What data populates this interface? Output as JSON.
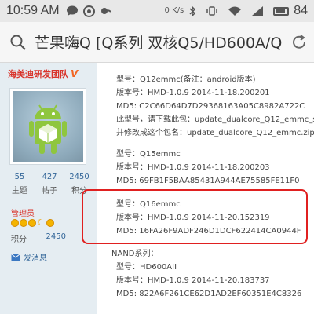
{
  "status_bar": {
    "time": "10:59 AM",
    "net_speed": "0 K/s",
    "battery": "84",
    "battery_level": 0.84,
    "icons": [
      "chat-bubble-icon",
      "circle-icon",
      "weather-icon",
      "bluetooth-icon",
      "vibrate-icon",
      "wifi-icon",
      "signal-icon",
      "battery-icon"
    ]
  },
  "title_bar": {
    "title": "芒果嗨Q [Q系列 双核Q5/HD600A/Q",
    "left_icon": "search-icon",
    "right_icon": "refresh-icon"
  },
  "user": {
    "name": "海美迪研发团队",
    "badge": "V",
    "stats": [
      {
        "value": "55",
        "label": "主题"
      },
      {
        "value": "427",
        "label": "帖子"
      },
      {
        "value": "2450",
        "label": "积分"
      }
    ],
    "role": "管理员",
    "points_label": "积分",
    "points_value": "2450",
    "send_message": "发消息"
  },
  "post": {
    "blocks": [
      {
        "lines": [
          "型号：Q12emmc(备注：android版本)",
          "版本号：HMD-1.0.9 2014-11-18.200201",
          "MD5: C2C66D64D7D29368163A05C8982A722C",
          "此型号，请下载此包：update_dualcore_Q12_emmc_s",
          "并修改成这个包名：update_dualcore_Q12_emmc.zip"
        ]
      },
      {
        "lines": [
          "型号：Q15emmc",
          "版本号：HMD-1.0.9 2014-11-18.200203",
          "MD5: 69FB1F5BAA85431A944AE75585FE11F0"
        ]
      },
      {
        "lines": [
          "型号：Q16emmc",
          "版本号：HMD-1.0.9 2014-11-20.152319",
          "MD5: 16FA26F9ADF246D1DCF622414CA0944F"
        ]
      }
    ],
    "nand": {
      "heading": "NAND系列：",
      "lines": [
        "型号：HD600AII",
        "版本号：HMD-1.0.9 2014-11-20.183737",
        "MD5:  822A6F261CE62D1AD2EF60351E4C8326"
      ]
    }
  }
}
